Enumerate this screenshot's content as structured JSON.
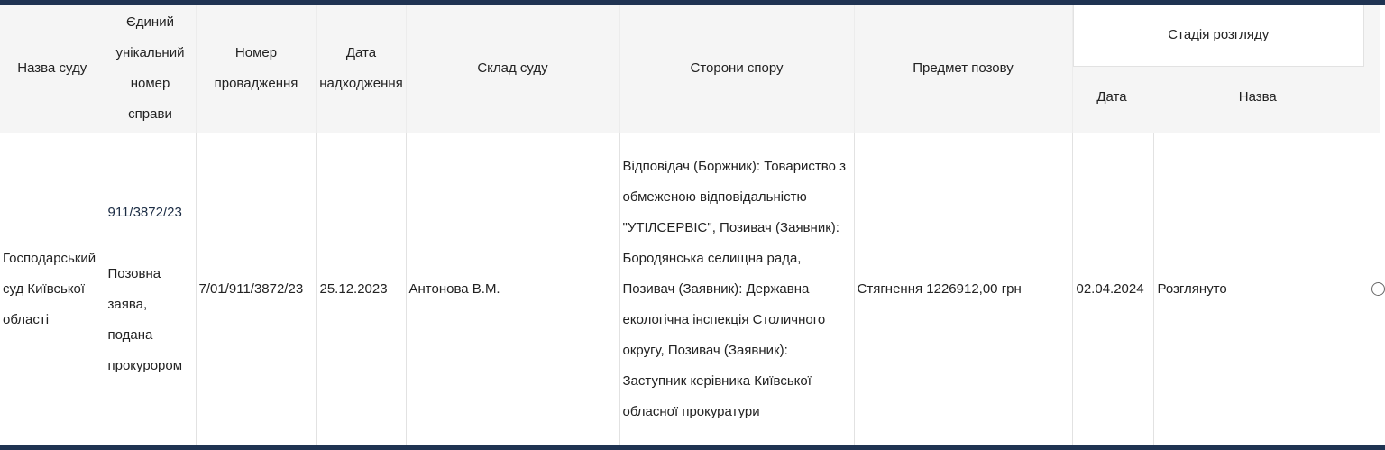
{
  "table": {
    "headers": {
      "court_name": "Назва суду",
      "case_number": "Єдиний унікальний номер справи",
      "proceeding_number": "Номер провадження",
      "receipt_date": "Дата надходження",
      "court_composition": "Склад суду",
      "parties": "Сторони спору",
      "subject": "Предмет позову",
      "stage": "Стадія розгляду",
      "stage_date": "Дата",
      "stage_name": "Назва"
    },
    "rows": [
      {
        "court_name": "Господарський суд Київської області",
        "case_number": "911/3872/23",
        "case_type": "Позовна заява, подана прокурором",
        "proceeding_number": "7/01/911/3872/23",
        "receipt_date": "25.12.2023",
        "court_composition": "Антонова В.М.",
        "parties": "Відповідач (Боржник): Товариство з обмеженою відповідальністю \"УТІЛСЕРВІС\", Позивач (Заявник): Бородянська селищна рада, Позивач (Заявник): Державна екологічна інспекція Столичного округу, Позивач (Заявник): Заступник керівника Київської обласної прокуратури",
        "subject": "Стягнення 1226912,00 грн",
        "stage_date": "02.04.2024",
        "stage_name": "Розглянуто"
      }
    ]
  },
  "colors": {
    "frame_border": "#1f3352",
    "header_background": "#f5f5f5",
    "case_link": "#1b2c44"
  }
}
